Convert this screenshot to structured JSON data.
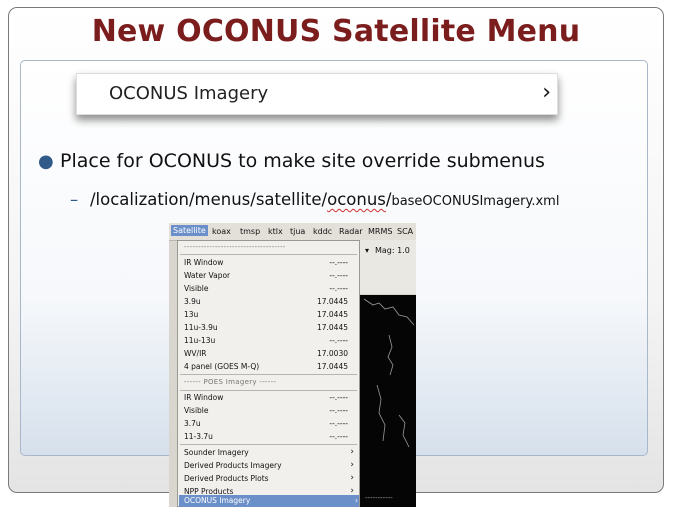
{
  "slide": {
    "title": "New OCONUS Satellite Menu",
    "banner": {
      "label": "OCONUS Imagery",
      "chevron": "›"
    },
    "bullet": "Place for OCONUS to make site override submenus",
    "subbullet": {
      "dash": "–",
      "path_before": "/localization/menus/satellite/",
      "path_oconus": "oconus",
      "path_slash": "/",
      "file": "baseOCONUSImagery.xml"
    }
  },
  "screenshot": {
    "menubar": [
      "Satellite",
      "koax",
      "tmsp",
      "ktlx",
      "tjua",
      "kddc",
      "Radar",
      "MRMS",
      "SCA"
    ],
    "toolbar": {
      "dropdown_arrow": "▾",
      "mag": "Mag: 1.0"
    },
    "menu": {
      "top_dashes": "------------------------------------",
      "goes_items": [
        {
          "label": "IR Window",
          "value": "--.----"
        },
        {
          "label": "Water Vapor",
          "value": "--.----"
        },
        {
          "label": "Visible",
          "value": "--.----"
        },
        {
          "label": "3.9u",
          "value": "17.0445"
        },
        {
          "label": "13u",
          "value": "17.0445"
        },
        {
          "label": "11u-3.9u",
          "value": "17.0445"
        },
        {
          "label": "11u-13u",
          "value": "--.----"
        },
        {
          "label": "WV/IR",
          "value": "17.0030"
        },
        {
          "label": "4 panel (GOES M-Q)",
          "value": "17.0445"
        }
      ],
      "poes_header": "------ POES Imagery ------",
      "poes_items": [
        {
          "label": "IR Window",
          "value": "--.----"
        },
        {
          "label": "Visible",
          "value": "--.----"
        },
        {
          "label": "3.7u",
          "value": "--.----"
        },
        {
          "label": "11-3.7u",
          "value": "--.----"
        }
      ],
      "sub_items": [
        {
          "label": "Sounder Imagery",
          "arrow": "›"
        },
        {
          "label": "Derived Products Imagery",
          "arrow": "›"
        },
        {
          "label": "Derived Products Plots",
          "arrow": "›"
        },
        {
          "label": "NPP Products",
          "arrow": "›"
        }
      ],
      "selected": {
        "label": "OCONUS Imagery",
        "arrow": "›",
        "trail": "-----------"
      }
    }
  },
  "colors": {
    "title": "#7b1d1d",
    "bullet": "#2f5a8a",
    "highlight": "#6b8fc8"
  }
}
